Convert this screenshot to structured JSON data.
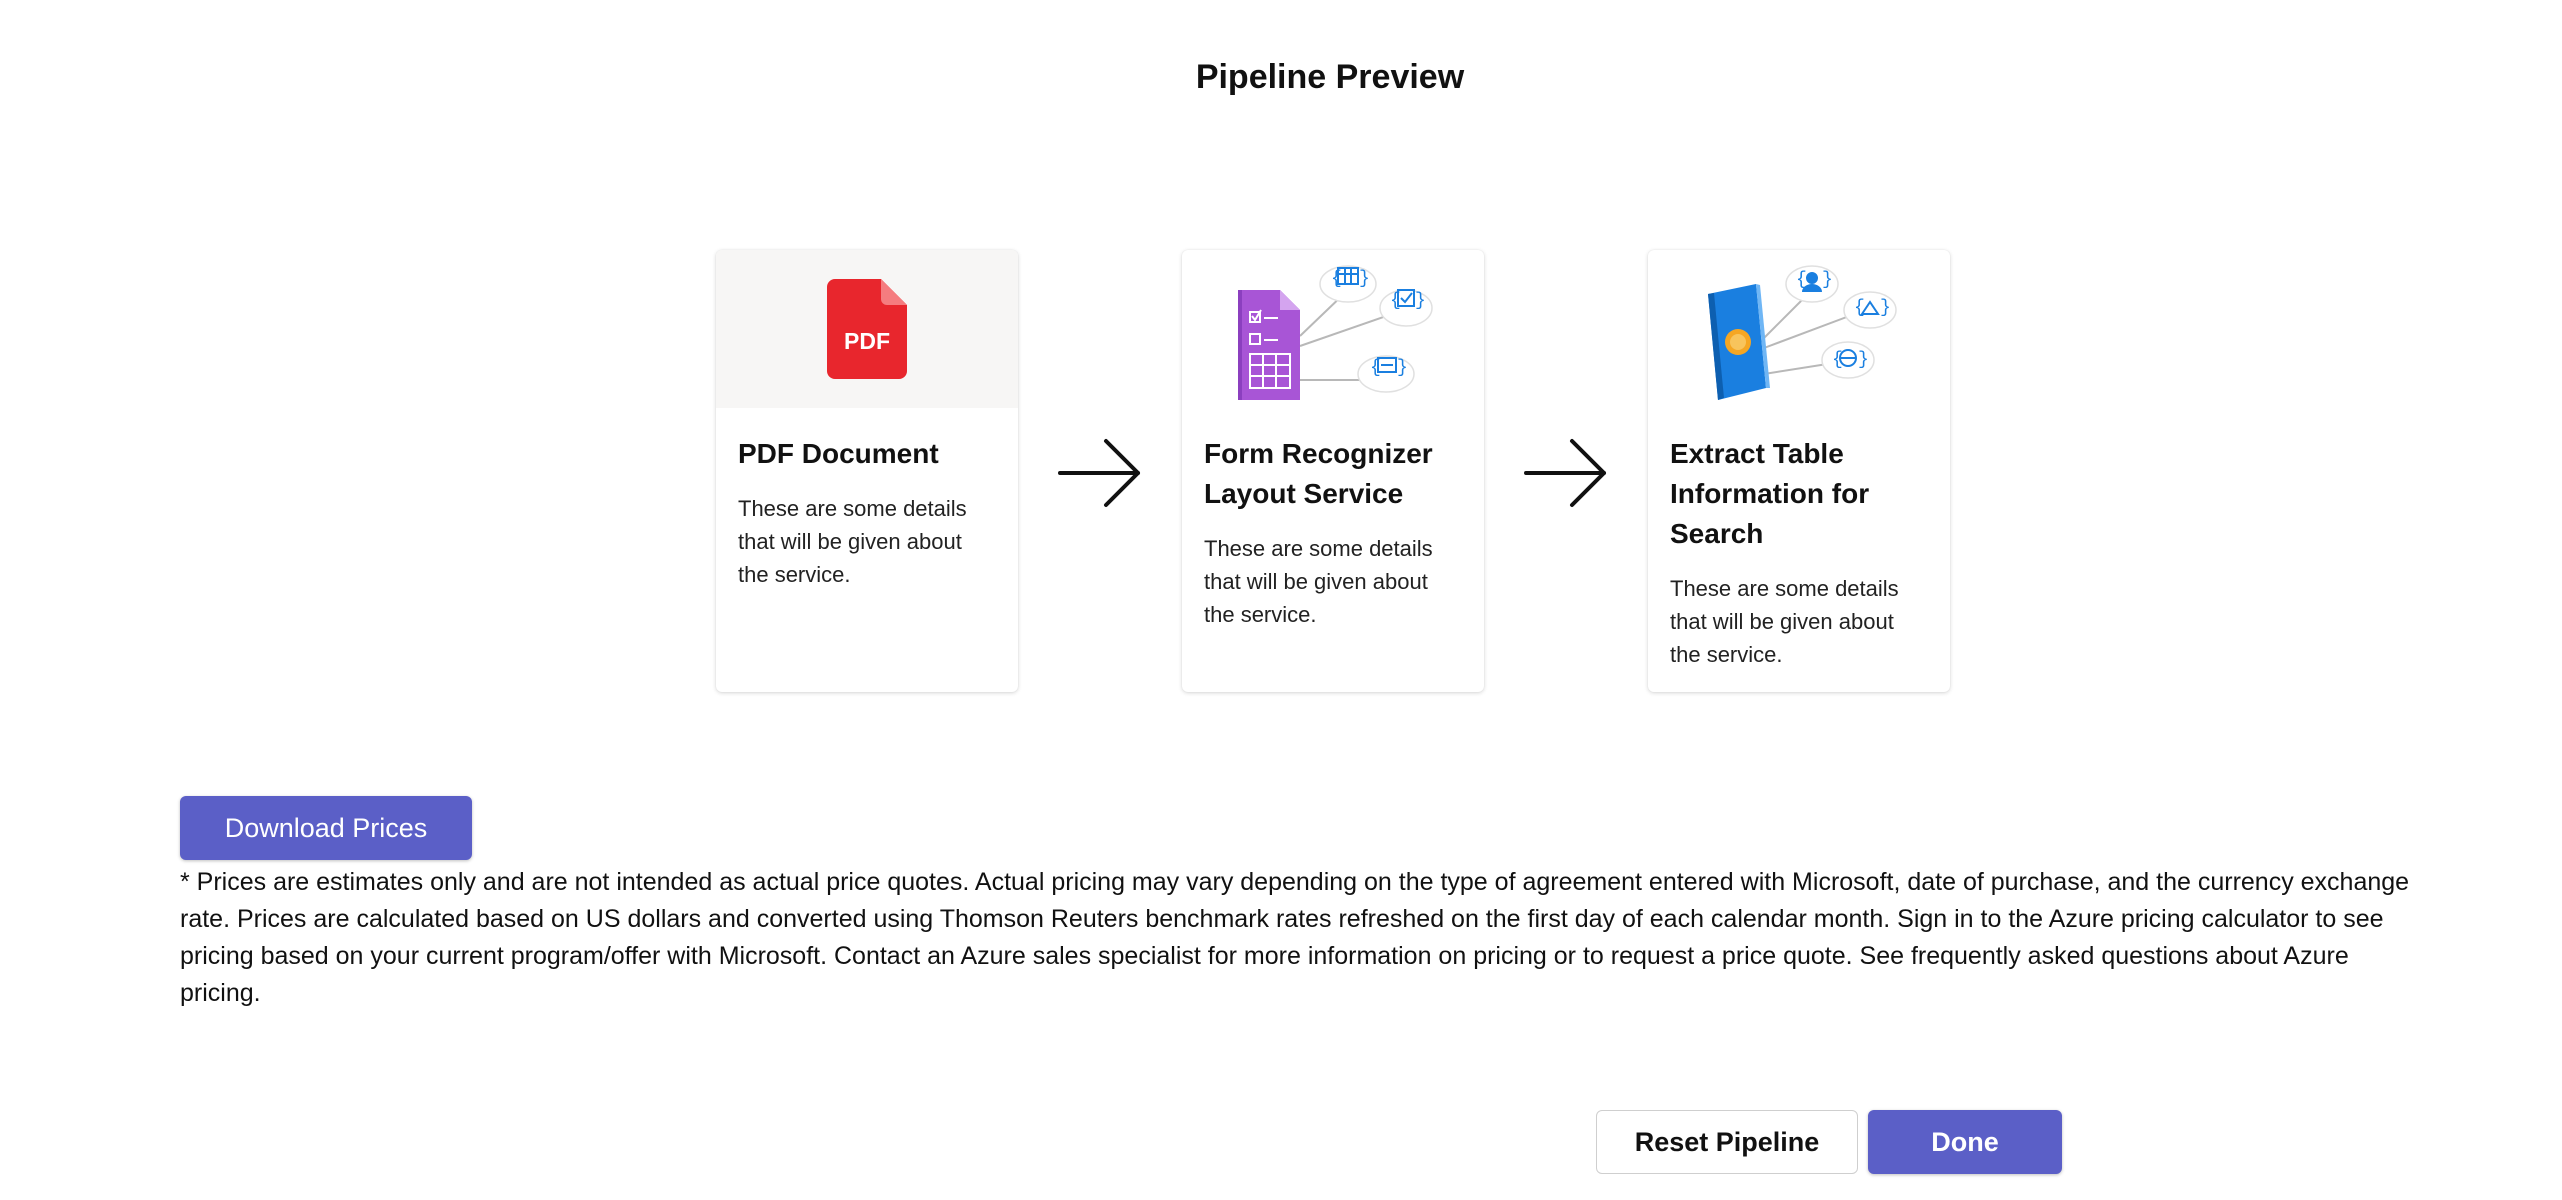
{
  "header": {
    "title": "Pipeline Preview"
  },
  "pipeline": {
    "cards": [
      {
        "title": "PDF Document",
        "description": "These are some details that will be given about the service.",
        "icon": "pdf-file-icon",
        "icon_text": "PDF"
      },
      {
        "title": "Form Recognizer Layout Service",
        "description": "These are some details that will be given about the service.",
        "icon": "form-recognizer-layout-icon"
      },
      {
        "title": "Extract Table Information for Search",
        "description": "These are some details that will be given about the service.",
        "icon": "extract-table-information-icon"
      }
    ],
    "connector_icon": "arrow-right-icon"
  },
  "pricing": {
    "download_label": "Download Prices",
    "disclaimer": "* Prices are estimates only and are not intended as actual price quotes. Actual pricing may vary depending on the type of agreement entered with Microsoft, date of purchase, and the currency exchange rate. Prices are calculated based on US dollars and converted using Thomson Reuters benchmark rates refreshed on the first day of each calendar month. Sign in to the Azure pricing calculator to see pricing based on your current program/offer with Microsoft. Contact an Azure sales specialist for more information on pricing or to request a price quote. See frequently asked questions about Azure pricing."
  },
  "footer": {
    "reset_label": "Reset Pipeline",
    "done_label": "Done"
  },
  "colors": {
    "accent": "#5b5fc7",
    "pdf_red": "#e8262d",
    "form_purple": "#a855d6",
    "extract_blue": "#1a7fe0"
  }
}
